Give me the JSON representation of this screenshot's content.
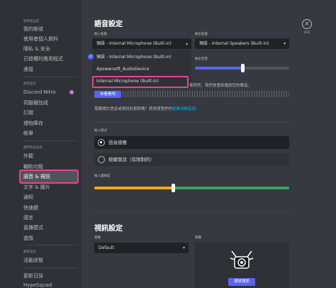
{
  "sidebar": {
    "user_settings_header": "使用者設定",
    "user_items": [
      "我的帳號",
      "使用者個人資料",
      "隱私 & 安全",
      "已授權的應用程式",
      "連接"
    ],
    "billing_header": "帳單設定",
    "billing_items": [
      "Discord Nitro",
      "伺服器加成",
      "訂閱",
      "禮物庫存",
      "帳單"
    ],
    "app_header": "應用程式設定",
    "app_items": [
      "外觀",
      "輔助功能",
      "語音 & 視訊",
      "文字 & 圖片",
      "通知",
      "快速鍵",
      "語言",
      "直播模式",
      "進階"
    ],
    "activity_header": "動態設定",
    "activity_items": [
      "活動狀態"
    ],
    "other_items": [
      "更新日誌",
      "HypeSquad"
    ]
  },
  "voice": {
    "title": "語音設定",
    "input_device_label": "輸入裝置",
    "input_device_value": "預設 - Internal Microphone (Built-in)",
    "output_device_label": "輸出裝置",
    "output_device_value": "預設 - Internal Speakers (Built-in)",
    "output_volume_label": "輸出音量",
    "output_volume_fraction": 0.5,
    "dropdown_options": [
      "預設 - Internal Microphone (Built-in)",
      "Apowersoft_AudioDevice",
      "Internal Microphone (Built-in)"
    ],
    "test_hint": "東西吧，我們會重新播放您的聲音。",
    "lets_check_button": "來看看吧",
    "help_text": "需要關於語音或視訊的幫助嗎？請參閱我們的",
    "help_link": "疑難排解指南。",
    "input_mode_label": "輸入模式",
    "input_modes": [
      "語音感應",
      "按鍵發話（有限制的）"
    ],
    "sensitivity_label": "輸入靈敏度"
  },
  "video": {
    "title": "視訊設定",
    "camera_label": "相機",
    "camera_value": "Default",
    "preview_label": "預覽",
    "test_video_button": "測試視訊"
  },
  "close": {
    "label": "ESC"
  },
  "colors": {
    "accent": "#5865f2",
    "highlight": "#e84393",
    "sensitivity_green": "#3ba55d",
    "sensitivity_yellow": "#faa61a"
  }
}
